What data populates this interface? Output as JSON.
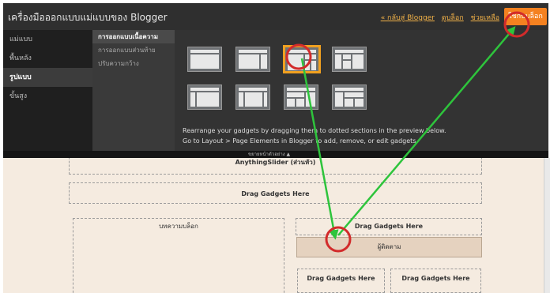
{
  "window": {
    "title": "เครื่องมือออกแบบแม่แบบของ Blogger",
    "links": [
      "« กลับสู่ Blogger",
      "ดูบล็อก",
      "ช่วยเหลือ"
    ],
    "apply_label": "ใช้กับบล็อก"
  },
  "nav": [
    "แม่แบบ",
    "พื้นหลัง",
    "รูปแบบ",
    "ขั้นสูง"
  ],
  "nav_active": "รูปแบบ",
  "subnav": [
    "การออกแบบเนื้อความ",
    "การออกแบบส่วนท้าย",
    "ปรับความกว้าง"
  ],
  "subnav_active": "การออกแบบเนื้อความ",
  "hint": {
    "line1": "Rearrange your gadgets by dragging them to dotted sections in the preview below.",
    "line2": "Go to Layout > Page Elements in Blogger to add, remove, or edit gadgets."
  },
  "divider_label": "ขยายหน้าตัวอย่าง ▲",
  "preview": {
    "top_gadget": "AnythingSlider (ส่วนหัว)",
    "drag_here": "Drag Gadgets Here",
    "main_label": "บทความบล็อก",
    "follower_gadget": "ผู้ติดตาม"
  },
  "annotations": {
    "circle_color": "#d22b2b",
    "arrow_color": "#2ec43c",
    "selected_border_color": "#f0a020",
    "apply_button_color": "#f48120"
  }
}
